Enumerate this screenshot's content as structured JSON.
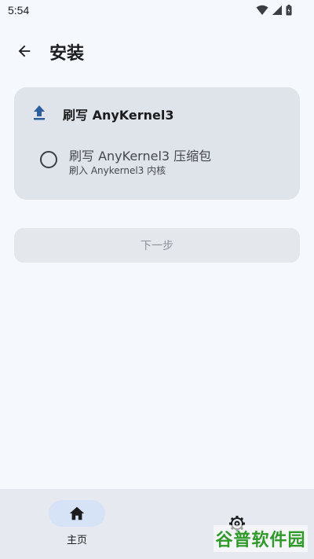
{
  "status_bar": {
    "time": "5:54",
    "icons": [
      "wifi-icon",
      "signal-icon",
      "battery-icon"
    ]
  },
  "app_bar": {
    "back_icon": "arrow-left-icon",
    "title": "安装"
  },
  "card": {
    "header_icon": "upload-icon",
    "title": "刷写 AnyKernel3",
    "option": {
      "selected": false,
      "title": "刷写 AnyKernel3 压缩包",
      "subtitle": "刷入 Anykernel3 内核"
    }
  },
  "next_button": {
    "label": "下一步",
    "enabled": false
  },
  "bottom_nav": {
    "items": [
      {
        "label": "主页",
        "icon": "home-icon",
        "selected": true
      },
      {
        "label": "",
        "icon": "gear-icon",
        "selected": false
      }
    ]
  },
  "watermark": "谷普软件园",
  "colors": {
    "background": "#f5f9fe",
    "card": "#dfe3ea",
    "accent": "#2c5f9e",
    "nav_pill": "#d6e3f7",
    "watermark": "#2f9a2a"
  }
}
